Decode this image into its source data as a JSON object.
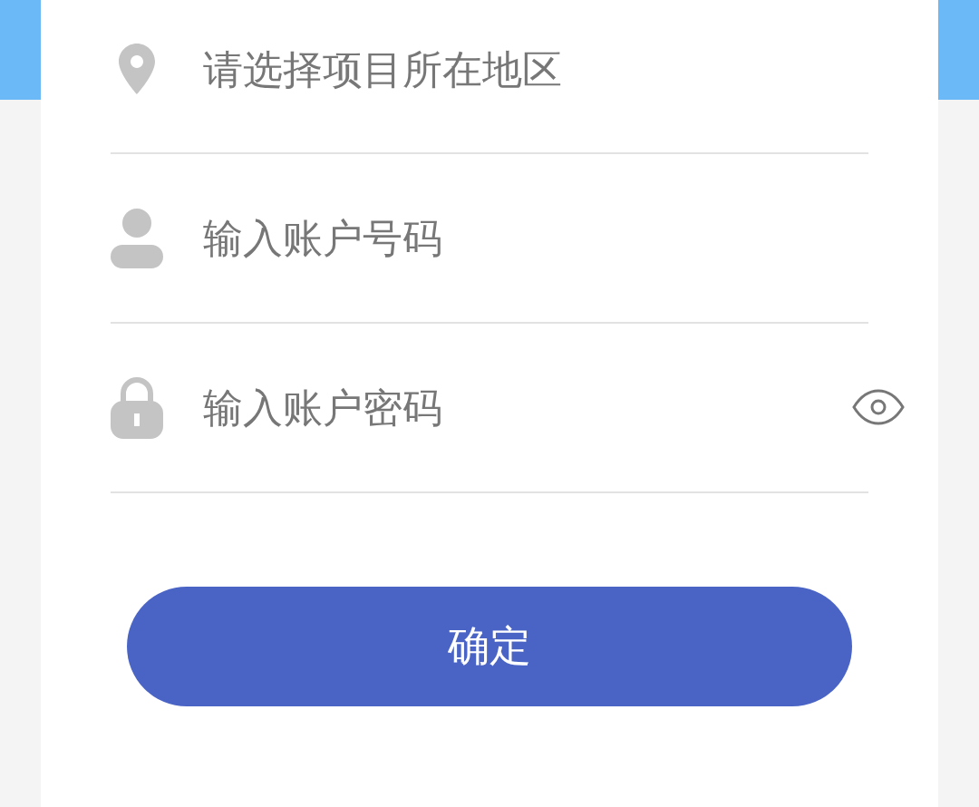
{
  "fields": [
    {
      "kind": "location",
      "placeholder": "请选择项目所在地区"
    },
    {
      "kind": "account",
      "placeholder": "输入账户号码"
    },
    {
      "kind": "password",
      "placeholder": "输入账户密码"
    }
  ],
  "submit_button": {
    "label": "确定"
  }
}
